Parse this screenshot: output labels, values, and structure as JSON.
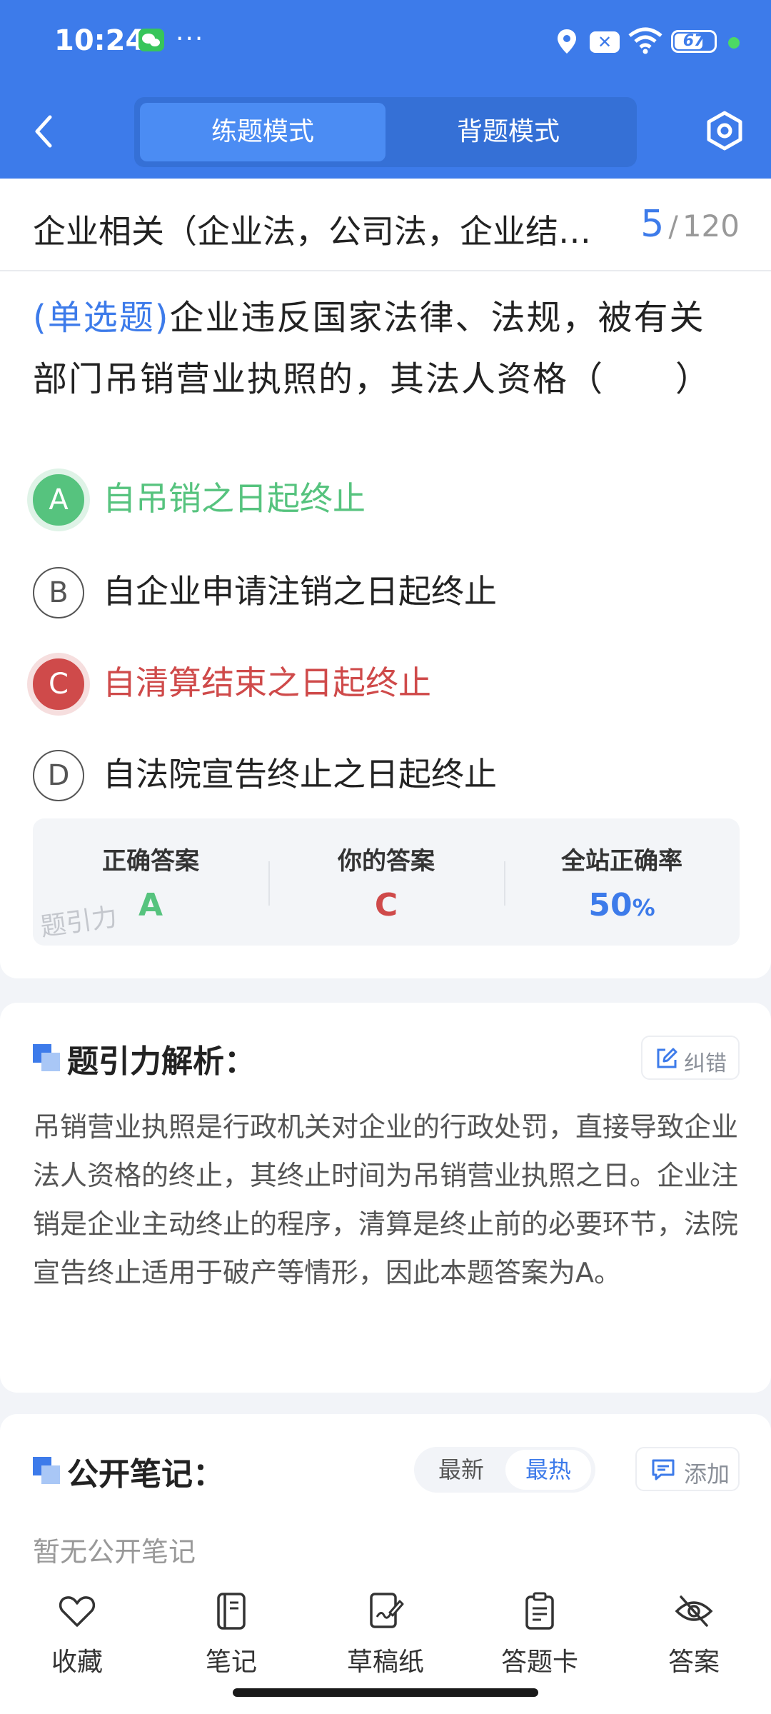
{
  "status_bar": {
    "time": "10:24",
    "battery": "67",
    "more": "···"
  },
  "header": {
    "modes": [
      {
        "label": "练题模式",
        "active": true
      },
      {
        "label": "背题模式",
        "active": false
      }
    ],
    "colors": {
      "primary": "#3d7bea",
      "correct": "#56c37e",
      "wrong": "#cf4a4a"
    }
  },
  "chapter": {
    "title": "企业相关（企业法，公司法，企业结…",
    "current": "5",
    "separator": "/",
    "total": "120"
  },
  "question": {
    "type": "(单选题)",
    "text": "企业违反国家法律、法规，被有关部门吊销营业执照的，其法人资格（　　）",
    "options": [
      {
        "letter": "A",
        "text": "自吊销之日起终止",
        "state": "correct"
      },
      {
        "letter": "B",
        "text": "自企业申请注销之日起终止",
        "state": "normal"
      },
      {
        "letter": "C",
        "text": "自清算结束之日起终止",
        "state": "wrong"
      },
      {
        "letter": "D",
        "text": "自法院宣告终止之日起终止",
        "state": "normal"
      }
    ]
  },
  "answer_summary": {
    "correct_title": "正确答案",
    "correct_value": "A",
    "yours_title": "你的答案",
    "yours_value": "C",
    "rate_title": "全站正确率",
    "rate_value": "50",
    "rate_unit": "%",
    "watermark": "题引力"
  },
  "analysis": {
    "title": "题引力解析：",
    "report_label": "纠错",
    "text": "吊销营业执照是行政机关对企业的行政处罚，直接导致企业法人资格的终止，其终止时间为吊销营业执照之日。企业注销是企业主动终止的程序，清算是终止前的必要环节，法院宣告终止适用于破产等情形，因此本题答案为A。"
  },
  "notes": {
    "title": "公开笔记：",
    "sort_newest": "最新",
    "sort_hottest": "最热",
    "add_label": "添加",
    "empty": "暂无公开笔记"
  },
  "bottom_nav": [
    {
      "label": "收藏",
      "icon": "heart-icon"
    },
    {
      "label": "笔记",
      "icon": "notebook-icon"
    },
    {
      "label": "草稿纸",
      "icon": "draft-icon"
    },
    {
      "label": "答题卡",
      "icon": "answer-card-icon"
    },
    {
      "label": "答案",
      "icon": "eye-off-icon"
    }
  ]
}
